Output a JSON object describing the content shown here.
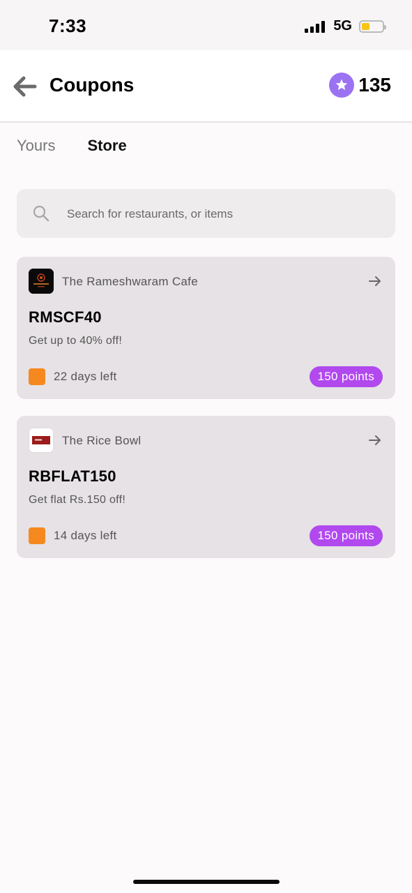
{
  "status_bar": {
    "time": "7:33",
    "network": "5G"
  },
  "header": {
    "title": "Coupons",
    "points": "135"
  },
  "tabs": [
    {
      "label": "Yours",
      "active": false
    },
    {
      "label": "Store",
      "active": true
    }
  ],
  "search": {
    "placeholder": "Search for restaurants, or items",
    "value": ""
  },
  "coupons": [
    {
      "restaurant": "The Rameshwaram Cafe",
      "code": "RMSCF40",
      "description": "Get up to 40% off!",
      "expiry": "22 days left",
      "cost": "150 points"
    },
    {
      "restaurant": "The Rice Bowl",
      "code": "RBFLAT150",
      "description": "Get flat Rs.150 off!",
      "expiry": "14 days left",
      "cost": "150 points"
    }
  ],
  "colors": {
    "accent_purple": "#b149ef",
    "star_badge": "#9b72f2",
    "expiry_orange": "#f5891f",
    "card_bg": "#e6e2e5"
  },
  "icons": {
    "back": "arrow-left-icon",
    "star": "star-icon",
    "search": "search-icon",
    "card_arrow": "arrow-right-icon"
  }
}
